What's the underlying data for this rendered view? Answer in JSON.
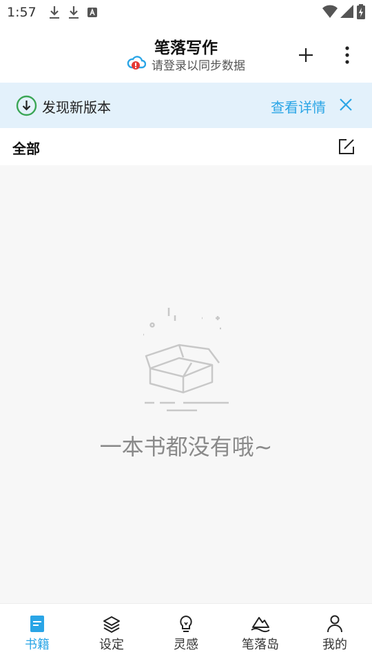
{
  "status_bar": {
    "time": "1:57",
    "icons": [
      "download-icon",
      "download-icon",
      "font-icon",
      "wifi-icon",
      "signal-icon",
      "battery-icon"
    ]
  },
  "header": {
    "title": "笔落写作",
    "sync_text": "请登录以同步数据",
    "cloud_icon": "cloud-alert-icon",
    "add_icon": "plus-icon",
    "more_icon": "more-vertical-icon"
  },
  "update_banner": {
    "text": "发现新版本",
    "link": "查看详情",
    "icon": "download-circle-icon",
    "close_icon": "close-icon"
  },
  "section": {
    "title": "全部",
    "edit_icon": "edit-icon"
  },
  "empty_state": {
    "icon": "empty-box-icon",
    "text": "一本书都没有哦~"
  },
  "bottom_nav": {
    "items": [
      {
        "label": "书籍",
        "icon": "book-icon",
        "active": true
      },
      {
        "label": "设定",
        "icon": "layers-icon",
        "active": false
      },
      {
        "label": "灵感",
        "icon": "lightbulb-icon",
        "active": false
      },
      {
        "label": "笔落岛",
        "icon": "island-icon",
        "active": false
      },
      {
        "label": "我的",
        "icon": "user-icon",
        "active": false
      }
    ]
  },
  "colors": {
    "accent": "#2aa5e6",
    "banner_bg": "#e3f1fb",
    "update_green": "#3aa655",
    "empty_bg": "#f7f7f7"
  }
}
